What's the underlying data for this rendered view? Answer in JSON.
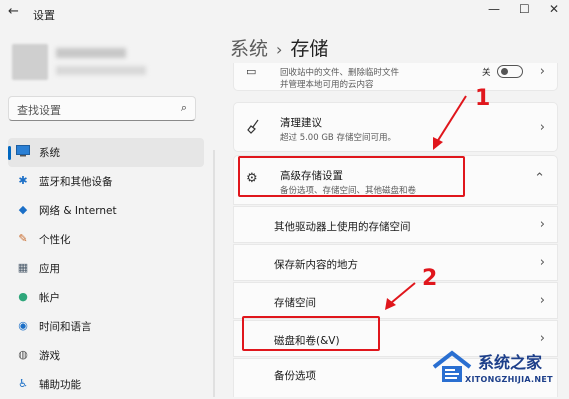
{
  "window": {
    "title": "设置",
    "back_icon": "back-arrow-icon"
  },
  "search": {
    "placeholder": "查找设置"
  },
  "sidebar": {
    "items": [
      {
        "label": "系统",
        "icon": "system-icon",
        "active": true
      },
      {
        "label": "蓝牙和其他设备",
        "icon": "bluetooth-icon"
      },
      {
        "label": "网络 & Internet",
        "icon": "network-icon"
      },
      {
        "label": "个性化",
        "icon": "brush-icon"
      },
      {
        "label": "应用",
        "icon": "apps-icon"
      },
      {
        "label": "帐户",
        "icon": "account-icon"
      },
      {
        "label": "时间和语言",
        "icon": "globe-icon"
      },
      {
        "label": "游戏",
        "icon": "game-icon"
      },
      {
        "label": "辅助功能",
        "icon": "accessibility-icon"
      }
    ]
  },
  "breadcrumb": {
    "parent": "系统",
    "separator": "›",
    "current": "存储"
  },
  "main": {
    "top_card": {
      "subtitle1": "回收站中的文件、删除临时文件",
      "subtitle2": "并管理本地可用的云内容",
      "toggle_label": "关",
      "toggle_on": false
    },
    "cleanup": {
      "title": "清理建议",
      "subtitle": "超过 5.00 GB 存储空间可用。"
    },
    "advanced": {
      "title": "高级存储设置",
      "subtitle": "备份选项、存储空间、其他磁盘和卷",
      "expanded": true
    },
    "sub_items": [
      {
        "title": "其他驱动器上使用的存储空间"
      },
      {
        "title": "保存新内容的地方"
      },
      {
        "title": "存储空间"
      },
      {
        "title": "磁盘和卷(&V)"
      },
      {
        "title": "备份选项"
      }
    ]
  },
  "annotations": {
    "label1": "1",
    "label2": "2",
    "color": "#e0161c"
  },
  "watermark": {
    "text": "系统之家",
    "url": "XITONGZHIJIA.NET"
  },
  "colors": {
    "accent": "#0067c0",
    "highlight": "#e0161c"
  }
}
